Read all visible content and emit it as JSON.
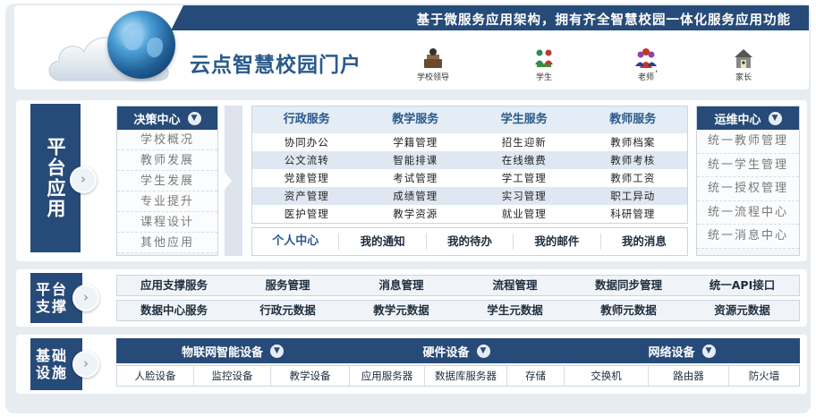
{
  "header": {
    "slogan": "基于微服务应用架构，拥有齐全智慧校园一体化服务应用功能",
    "portal_title": "云点智慧校园门户",
    "roles": [
      {
        "label": "学校领导",
        "icon": "leader-icon"
      },
      {
        "label": "学生",
        "icon": "student-icon"
      },
      {
        "label": "老师",
        "icon": "teacher-icon"
      },
      {
        "label": "家长",
        "icon": "parent-home-icon"
      }
    ],
    "stray_mark": ","
  },
  "platform_apps": {
    "title": "平台应用",
    "decision_center": {
      "title": "决策中心",
      "items": [
        "学校概况",
        "教师发展",
        "学生发展",
        "专业提升",
        "课程设计",
        "其他应用"
      ]
    },
    "services": {
      "headers": [
        "行政服务",
        "教学服务",
        "学生服务",
        "教师服务"
      ],
      "rows": [
        [
          "协同办公",
          "学籍管理",
          "招生迎新",
          "教师档案"
        ],
        [
          "公文流转",
          "智能排课",
          "在线缴费",
          "教师考核"
        ],
        [
          "党建管理",
          "考试管理",
          "学工管理",
          "教师工资"
        ],
        [
          "资产管理",
          "成绩管理",
          "实习管理",
          "职工异动"
        ],
        [
          "医护管理",
          "教学资源",
          "就业管理",
          "科研管理"
        ]
      ]
    },
    "personal": [
      "个人中心",
      "我的通知",
      "我的待办",
      "我的邮件",
      "我的消息"
    ],
    "ops_center": {
      "title": "运维中心",
      "items": [
        "统一教师管理",
        "统一学生管理",
        "统一授权管理",
        "统一流程中心",
        "统一消息中心"
      ]
    }
  },
  "platform_support": {
    "title_line1": "平台",
    "title_line2": "支撑",
    "row1": [
      "应用支撑服务",
      "服务管理",
      "消息管理",
      "流程管理",
      "数据同步管理",
      "统一API接口"
    ],
    "row2": [
      "数据中心服务",
      "行政元数据",
      "教学元数据",
      "学生元数据",
      "教师元数据",
      "资源元数据"
    ]
  },
  "infrastructure": {
    "title_line1": "基础",
    "title_line2": "设施",
    "groups": [
      "物联网智能设备",
      "硬件设备",
      "网络设备"
    ],
    "items": [
      "人脸设备",
      "监控设备",
      "教学设备",
      "应用服务器",
      "数据库服务器",
      "存储",
      "交换机",
      "路由器",
      "防火墙"
    ]
  },
  "colors": {
    "primary_navy": "#274b78",
    "accent_blue": "#2a5a8c",
    "panel_bg": "#e7ecf1"
  }
}
